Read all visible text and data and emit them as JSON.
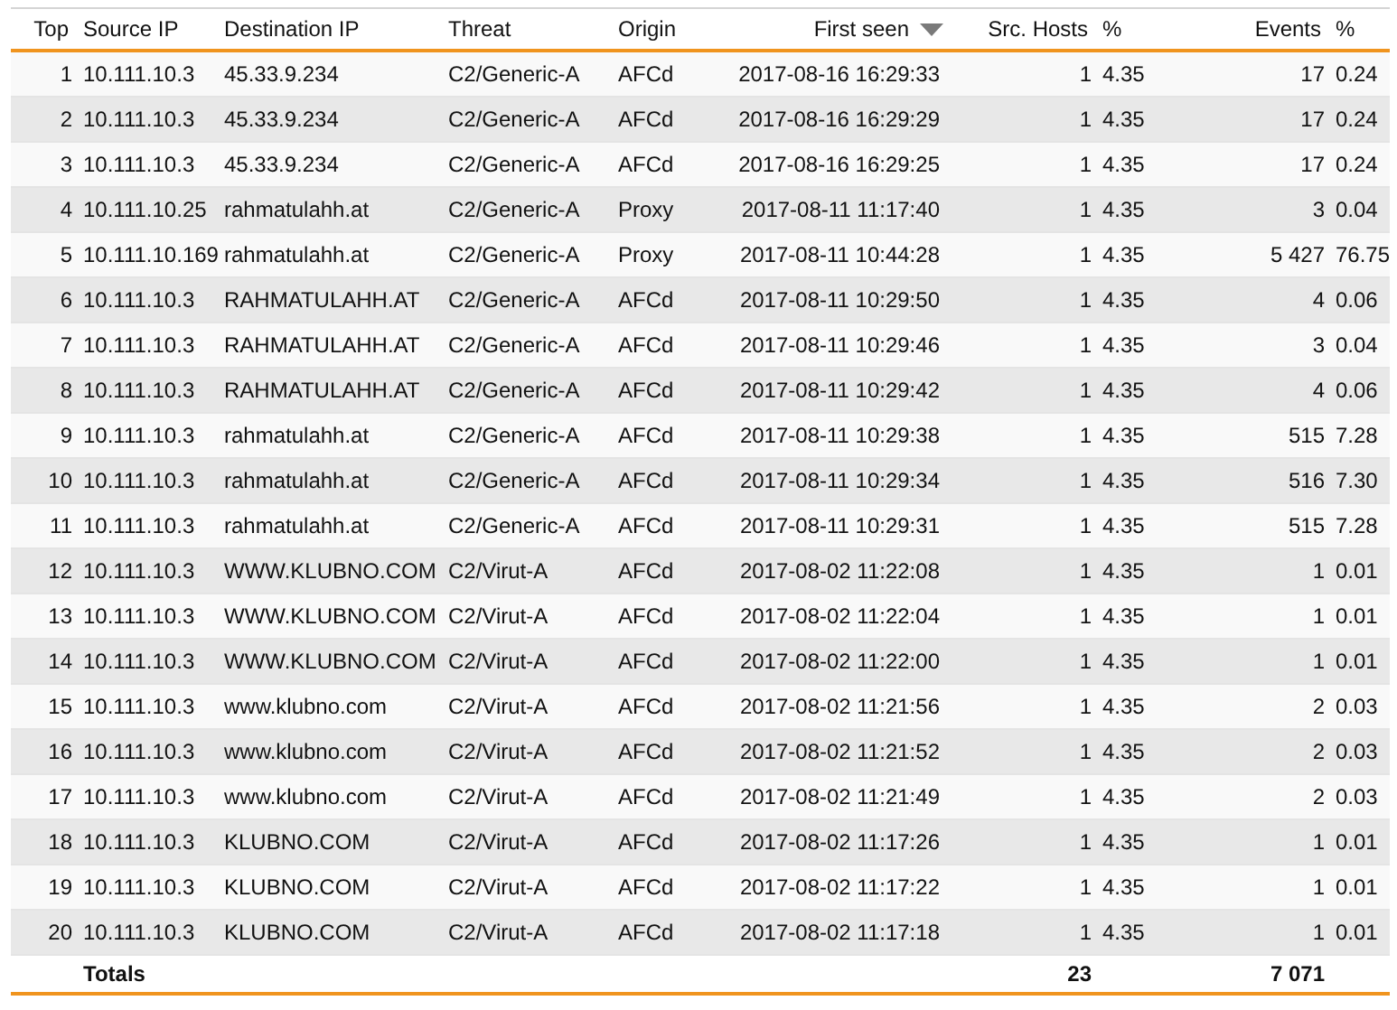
{
  "table": {
    "columns": [
      {
        "label": "Top",
        "sorted": false
      },
      {
        "label": "Source IP",
        "sorted": false
      },
      {
        "label": "Destination IP",
        "sorted": false
      },
      {
        "label": "Threat",
        "sorted": false
      },
      {
        "label": "Origin",
        "sorted": false
      },
      {
        "label": "First seen",
        "sorted": true
      },
      {
        "label": "Src. Hosts",
        "sorted": false
      },
      {
        "label": "%",
        "sorted": false
      },
      {
        "label": "Events",
        "sorted": false
      },
      {
        "label": "%",
        "sorted": false
      }
    ],
    "rows": [
      [
        "1",
        "10.111.10.3",
        "45.33.9.234",
        "C2/Generic-A",
        "AFCd",
        "2017-08-16 16:29:33",
        "1",
        "4.35",
        "17",
        "0.24"
      ],
      [
        "2",
        "10.111.10.3",
        "45.33.9.234",
        "C2/Generic-A",
        "AFCd",
        "2017-08-16 16:29:29",
        "1",
        "4.35",
        "17",
        "0.24"
      ],
      [
        "3",
        "10.111.10.3",
        "45.33.9.234",
        "C2/Generic-A",
        "AFCd",
        "2017-08-16 16:29:25",
        "1",
        "4.35",
        "17",
        "0.24"
      ],
      [
        "4",
        "10.111.10.25",
        "rahmatulahh.at",
        "C2/Generic-A",
        "Proxy",
        "2017-08-11 11:17:40",
        "1",
        "4.35",
        "3",
        "0.04"
      ],
      [
        "5",
        "10.111.10.169",
        "rahmatulahh.at",
        "C2/Generic-A",
        "Proxy",
        "2017-08-11 10:44:28",
        "1",
        "4.35",
        "5 427",
        "76.75"
      ],
      [
        "6",
        "10.111.10.3",
        "RAHMATULAHH.AT",
        "C2/Generic-A",
        "AFCd",
        "2017-08-11 10:29:50",
        "1",
        "4.35",
        "4",
        "0.06"
      ],
      [
        "7",
        "10.111.10.3",
        "RAHMATULAHH.AT",
        "C2/Generic-A",
        "AFCd",
        "2017-08-11 10:29:46",
        "1",
        "4.35",
        "3",
        "0.04"
      ],
      [
        "8",
        "10.111.10.3",
        "RAHMATULAHH.AT",
        "C2/Generic-A",
        "AFCd",
        "2017-08-11 10:29:42",
        "1",
        "4.35",
        "4",
        "0.06"
      ],
      [
        "9",
        "10.111.10.3",
        "rahmatulahh.at",
        "C2/Generic-A",
        "AFCd",
        "2017-08-11 10:29:38",
        "1",
        "4.35",
        "515",
        "7.28"
      ],
      [
        "10",
        "10.111.10.3",
        "rahmatulahh.at",
        "C2/Generic-A",
        "AFCd",
        "2017-08-11 10:29:34",
        "1",
        "4.35",
        "516",
        "7.30"
      ],
      [
        "11",
        "10.111.10.3",
        "rahmatulahh.at",
        "C2/Generic-A",
        "AFCd",
        "2017-08-11 10:29:31",
        "1",
        "4.35",
        "515",
        "7.28"
      ],
      [
        "12",
        "10.111.10.3",
        "WWW.KLUBNO.COM",
        "C2/Virut-A",
        "AFCd",
        "2017-08-02 11:22:08",
        "1",
        "4.35",
        "1",
        "0.01"
      ],
      [
        "13",
        "10.111.10.3",
        "WWW.KLUBNO.COM",
        "C2/Virut-A",
        "AFCd",
        "2017-08-02 11:22:04",
        "1",
        "4.35",
        "1",
        "0.01"
      ],
      [
        "14",
        "10.111.10.3",
        "WWW.KLUBNO.COM",
        "C2/Virut-A",
        "AFCd",
        "2017-08-02 11:22:00",
        "1",
        "4.35",
        "1",
        "0.01"
      ],
      [
        "15",
        "10.111.10.3",
        "www.klubno.com",
        "C2/Virut-A",
        "AFCd",
        "2017-08-02 11:21:56",
        "1",
        "4.35",
        "2",
        "0.03"
      ],
      [
        "16",
        "10.111.10.3",
        "www.klubno.com",
        "C2/Virut-A",
        "AFCd",
        "2017-08-02 11:21:52",
        "1",
        "4.35",
        "2",
        "0.03"
      ],
      [
        "17",
        "10.111.10.3",
        "www.klubno.com",
        "C2/Virut-A",
        "AFCd",
        "2017-08-02 11:21:49",
        "1",
        "4.35",
        "2",
        "0.03"
      ],
      [
        "18",
        "10.111.10.3",
        "KLUBNO.COM",
        "C2/Virut-A",
        "AFCd",
        "2017-08-02 11:17:26",
        "1",
        "4.35",
        "1",
        "0.01"
      ],
      [
        "19",
        "10.111.10.3",
        "KLUBNO.COM",
        "C2/Virut-A",
        "AFCd",
        "2017-08-02 11:17:22",
        "1",
        "4.35",
        "1",
        "0.01"
      ],
      [
        "20",
        "10.111.10.3",
        "KLUBNO.COM",
        "C2/Virut-A",
        "AFCd",
        "2017-08-02 11:17:18",
        "1",
        "4.35",
        "1",
        "0.01"
      ]
    ],
    "totals": {
      "label": "Totals",
      "src_hosts": "23",
      "events": "7 071"
    }
  }
}
